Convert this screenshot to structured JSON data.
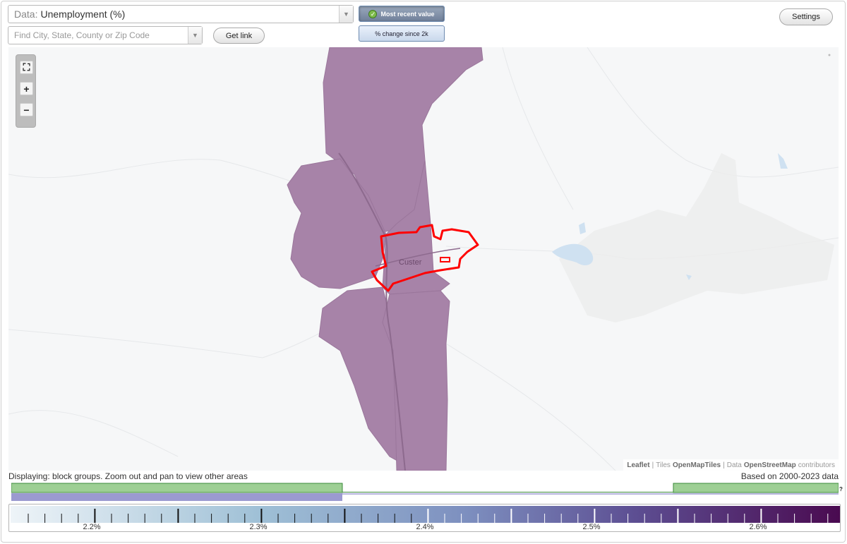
{
  "data_select": {
    "label": "Data:",
    "value": "Unemployment (%)"
  },
  "search": {
    "placeholder": "Find City, State, County or Zip Code"
  },
  "buttons": {
    "get_link": "Get link",
    "settings": "Settings",
    "most_recent": "Most recent value",
    "change_since": "% change since 2k"
  },
  "map": {
    "place_label": "Custer",
    "region_color": "#a783a8",
    "highlight_color": "#ff0000",
    "attribution": {
      "leaflet": "Leaflet",
      "sep": "|",
      "tiles_prefix": "Tiles",
      "tiles_name": "OpenMapTiles",
      "data_prefix": "Data",
      "data_name": "OpenStreetMap",
      "data_suffix": "contributors"
    },
    "zoom_controls": [
      "fullscreen-icon",
      "plus-icon",
      "minus-icon"
    ]
  },
  "status": {
    "displaying": "Displaying: block groups. Zoom out and pan to view other areas",
    "based_on": "Based on 2000-2023 data"
  },
  "histogram": {
    "help": "?"
  },
  "legend": {
    "labels": [
      "2.2%",
      "2.3%",
      "2.4%",
      "2.5%",
      "2.6%"
    ],
    "color_start": "#eef4f8",
    "color_end": "#4a0a50"
  }
}
